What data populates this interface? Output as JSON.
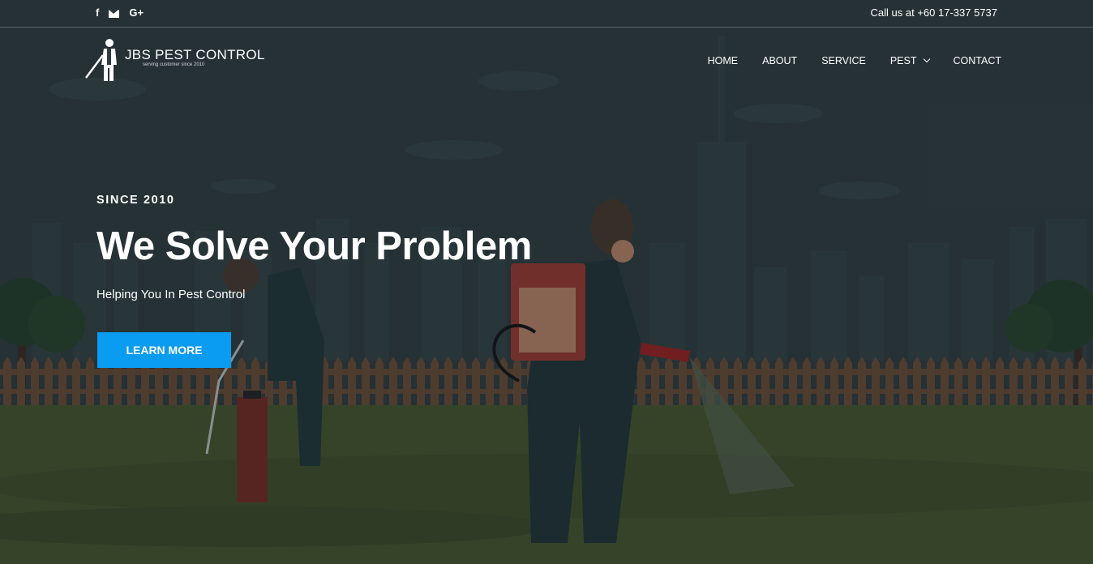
{
  "topbar": {
    "social": [
      {
        "name": "facebook-icon",
        "glyph": "f"
      },
      {
        "name": "email-icon",
        "glyph": ""
      },
      {
        "name": "google-plus-icon",
        "glyph": "G+"
      }
    ],
    "call_text": "Call us at +60 17-337 5737"
  },
  "brand": {
    "name": "JBS PEST CONTROL",
    "tagline": "serving customer since 2010"
  },
  "nav": {
    "items": [
      "HOME",
      "ABOUT",
      "SERVICE",
      "PEST",
      "CONTACT"
    ]
  },
  "hero": {
    "eyebrow": "SINCE 2010",
    "headline": "We Solve Your Problem",
    "subheadline": "Helping You In Pest Control",
    "cta_label": "LEARN MORE"
  },
  "colors": {
    "accent": "#0a9cf0",
    "sky": "#2f3d40",
    "grass": "#4a5a2e",
    "fence": "#6a4a34"
  }
}
